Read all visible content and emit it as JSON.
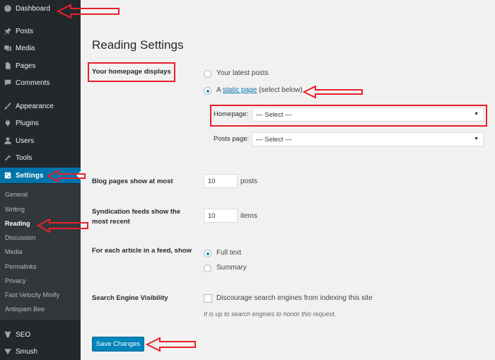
{
  "sidebar": {
    "items": [
      {
        "label": "Dashboard",
        "icon": "dashboard-icon"
      },
      {
        "label": "Posts",
        "icon": "pin-icon"
      },
      {
        "label": "Media",
        "icon": "media-icon"
      },
      {
        "label": "Pages",
        "icon": "pages-icon"
      },
      {
        "label": "Comments",
        "icon": "comment-icon"
      },
      {
        "label": "Appearance",
        "icon": "brush-icon"
      },
      {
        "label": "Plugins",
        "icon": "plug-icon"
      },
      {
        "label": "Users",
        "icon": "user-icon"
      },
      {
        "label": "Tools",
        "icon": "wrench-icon"
      },
      {
        "label": "Settings",
        "icon": "settings-icon"
      },
      {
        "label": "SEO",
        "icon": "seo-icon"
      },
      {
        "label": "Smush",
        "icon": "smush-icon"
      }
    ],
    "submenu": [
      "General",
      "Writing",
      "Reading",
      "Discussion",
      "Media",
      "Permalinks",
      "Privacy",
      "Fast Velocity Minify",
      "Antispam Bee"
    ]
  },
  "page": {
    "title": "Reading Settings",
    "homepage_displays": {
      "label": "Your homepage displays",
      "option_latest": "Your latest posts",
      "option_static_prefix": "A",
      "option_static_link": "static page",
      "option_static_suffix": "(select below)",
      "homepage_label": "Homepage:",
      "homepage_value": "— Select —",
      "posts_page_label": "Posts page:",
      "posts_page_value": "— Select —"
    },
    "blog_pages": {
      "label": "Blog pages show at most",
      "value": "10",
      "unit": "posts"
    },
    "syndication": {
      "label_line1": "Syndication feeds show the",
      "label_line2": "most recent",
      "value": "10",
      "unit": "items"
    },
    "feed_article": {
      "label": "For each article in a feed, show",
      "option_full": "Full text",
      "option_summary": "Summary"
    },
    "search_visibility": {
      "label": "Search Engine Visibility",
      "checkbox_label": "Discourage search engines from indexing this site",
      "description": "It is up to search engines to honor this request."
    },
    "save_label": "Save Changes"
  },
  "colors": {
    "sidebar": "#23282d",
    "accent": "#0073aa",
    "annotation": "#e8202a"
  }
}
